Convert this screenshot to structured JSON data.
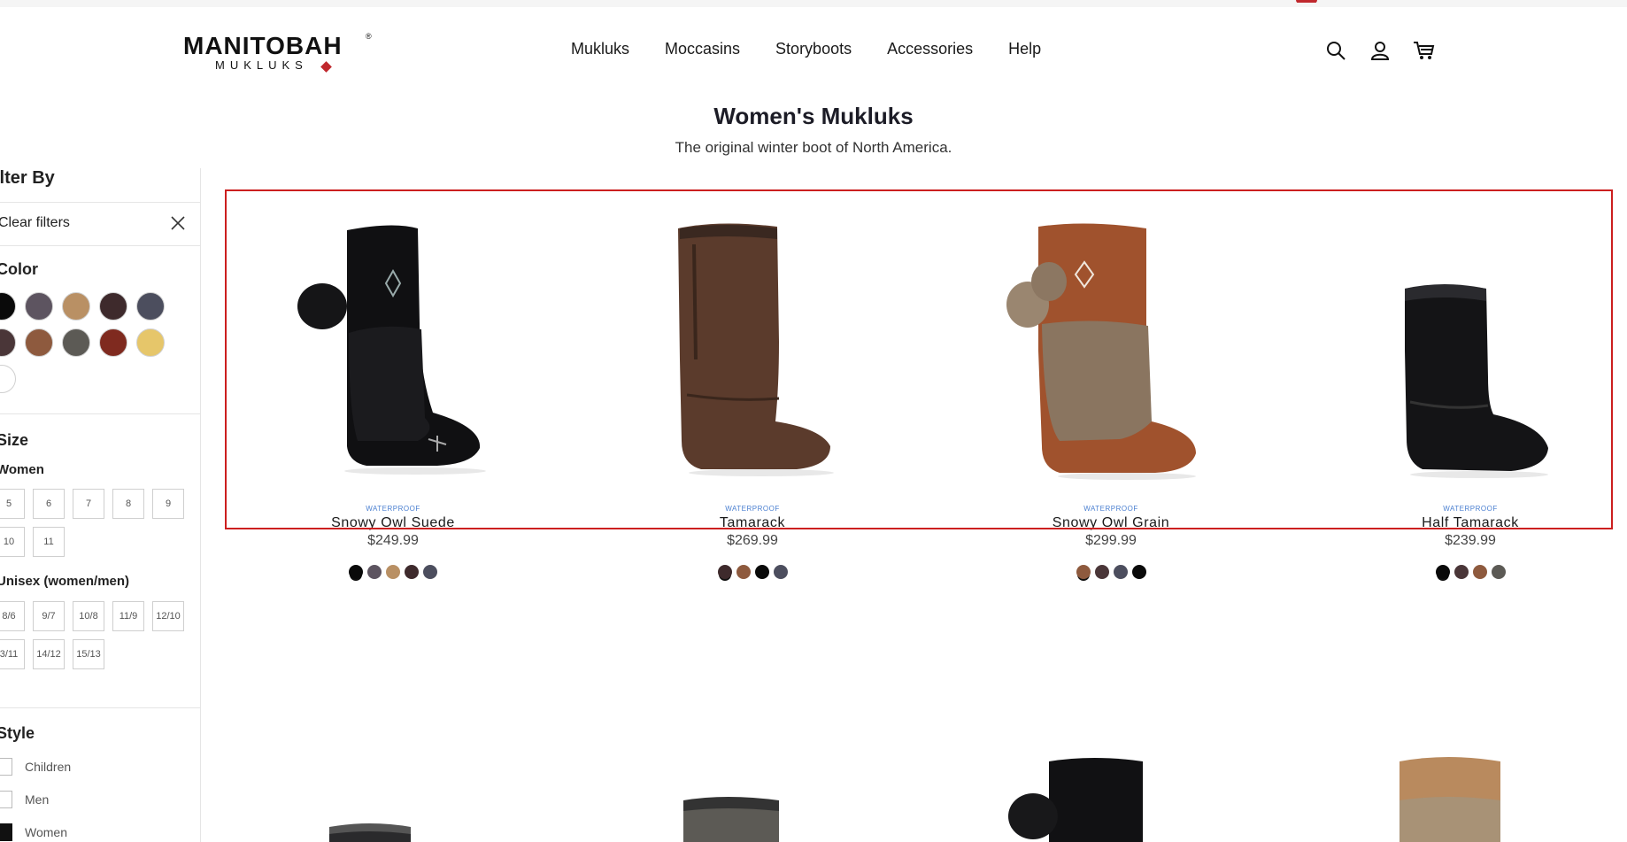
{
  "header": {
    "brand": "MANITOBAH",
    "brand_sub": "MUKLUKS",
    "nav": [
      "Mukluks",
      "Moccasins",
      "Storyboots",
      "Accessories",
      "Help"
    ],
    "icons": [
      "search-icon",
      "account-icon",
      "cart-icon"
    ]
  },
  "page": {
    "title": "Women's Mukluks",
    "subtitle": "The original winter boot of North America."
  },
  "sidebar": {
    "filter_heading": "ilter By",
    "clear_label": "Clear filters",
    "color_heading": "Color",
    "colors": [
      "#0a0a0a",
      "#5d5460",
      "#b99064",
      "#3e2a2c",
      "#4c4e5e",
      "#4a3638",
      "#8e5a3e",
      "#5c5a55",
      "#7f2a1f",
      "#e6c66a",
      "#ffffff"
    ],
    "size_heading": "Size",
    "women_label": "Women",
    "women_sizes": [
      "5",
      "6",
      "7",
      "8",
      "9",
      "10",
      "11"
    ],
    "unisex_label": "Unisex (women/men)",
    "unisex_sizes": [
      "8/6",
      "9/7",
      "10/8",
      "11/9",
      "12/10",
      "3/11",
      "14/12",
      "15/13"
    ],
    "style_heading": "Style",
    "style_options": [
      {
        "label": "Children",
        "checked": false
      },
      {
        "label": "Men",
        "checked": false
      },
      {
        "label": "Women",
        "checked": true
      }
    ]
  },
  "products": [
    {
      "badge": "WATERPROOF",
      "name": "Snowy Owl Suede",
      "price": "$249.99",
      "swatches": [
        "#0a0a0a",
        "#5d5460",
        "#b99064",
        "#3e2a2c",
        "#4c4e5e"
      ]
    },
    {
      "badge": "WATERPROOF",
      "name": "Tamarack",
      "price": "$269.99",
      "swatches": [
        "#3e2a2c",
        "#8e5a3e",
        "#0a0a0a",
        "#4c4e5e"
      ]
    },
    {
      "badge": "WATERPROOF",
      "name": "Snowy Owl Grain",
      "price": "$299.99",
      "swatches": [
        "#8e5a3e",
        "#4a3638",
        "#4c4e5e",
        "#0a0a0a"
      ]
    },
    {
      "badge": "WATERPROOF",
      "name": "Half Tamarack",
      "price": "$239.99",
      "swatches": [
        "#0a0a0a",
        "#4a3638",
        "#8e5a3e",
        "#5c5a55"
      ]
    }
  ]
}
